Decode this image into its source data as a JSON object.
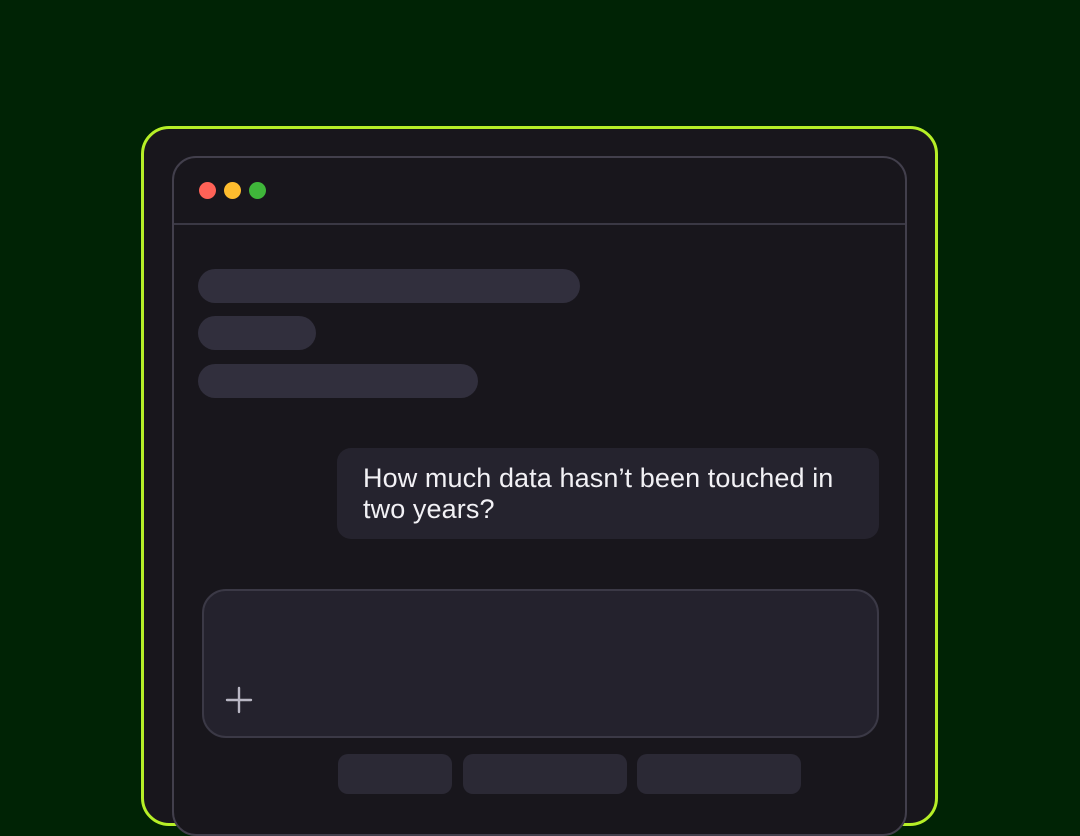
{
  "window": {
    "traffic_lights": [
      {
        "name": "close",
        "color": "#ff6257"
      },
      {
        "name": "minimize",
        "color": "#febc2e"
      },
      {
        "name": "zoom",
        "color": "#3fb63a"
      }
    ]
  },
  "conversation": {
    "user_message": "How much data hasn’t been touched in two years?"
  },
  "composer": {
    "attach_icon": "plus-icon"
  },
  "colors": {
    "page_background": "#002305",
    "frame_accent": "#b6ef27",
    "window_background": "#18161c",
    "skeleton": "#312f3d",
    "bubble": "#25232e"
  }
}
